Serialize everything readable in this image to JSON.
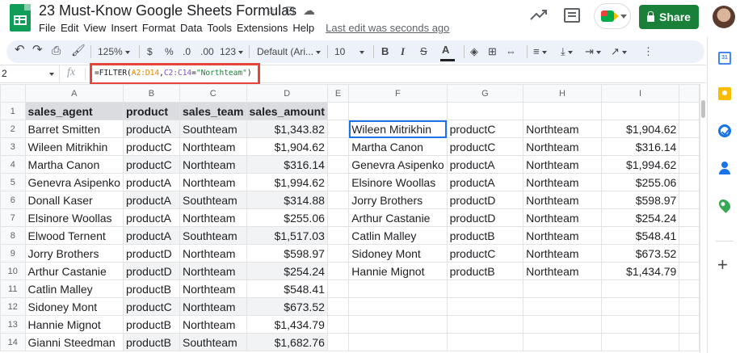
{
  "app": {
    "doc_title": "23 Must-Know Google Sheets Formulas",
    "menu": [
      "File",
      "Edit",
      "View",
      "Insert",
      "Format",
      "Data",
      "Tools",
      "Extensions",
      "Help"
    ],
    "last_edit": "Last edit was seconds ago",
    "share_label": "Share",
    "icons": [
      "star-icon",
      "move-to-folder-icon",
      "cloud-status-icon",
      "activity-trend-icon",
      "comment-icon",
      "meet-icon",
      "lock-icon",
      "avatar"
    ],
    "colors": {
      "share": "#188038",
      "highlight_box": "#e8433a",
      "selection": "#1a73e8"
    }
  },
  "toolbar": {
    "zoom": "125%",
    "currency": "$",
    "percent": "%",
    "decrease_decimal": ".0",
    "increase_decimal": ".00",
    "more_formats": "123",
    "font": "Default (Ari...",
    "font_size": "10",
    "bold": "B",
    "italic": "I",
    "strike": "S",
    "text_color": "A"
  },
  "formula_bar": {
    "name_box": "2",
    "fx": "fx",
    "formula_prefix": "=FILTER(",
    "range1": "A2:D14",
    "comma": ",",
    "range2": "C2:C14",
    "equals": "=",
    "criterion": "\"Northteam\"",
    "close": ")"
  },
  "columns": [
    "A",
    "B",
    "C",
    "D",
    "E",
    "F",
    "G",
    "H",
    "I"
  ],
  "rows": [
    [
      "sales_agent",
      "product",
      "sales_team",
      "sales_amount",
      "",
      "",
      "",
      "",
      ""
    ],
    [
      "Barret Smitten",
      "productA",
      "Southteam",
      "$1,343.82",
      "",
      "Wileen Mitrikhin",
      "productC",
      "Northteam",
      "$1,904.62"
    ],
    [
      "Wileen Mitrikhin",
      "productC",
      "Northteam",
      "$1,904.62",
      "",
      "Martha Canon",
      "productC",
      "Northteam",
      "$316.14"
    ],
    [
      "Martha Canon",
      "productC",
      "Northteam",
      "$316.14",
      "",
      "Genevra Asipenko",
      "productA",
      "Northteam",
      "$1,994.62"
    ],
    [
      "Genevra Asipenko",
      "productA",
      "Northteam",
      "$1,994.62",
      "",
      "Elsinore Woollas",
      "productA",
      "Northteam",
      "$255.06"
    ],
    [
      "Donall Kaser",
      "productA",
      "Southteam",
      "$314.88",
      "",
      "Jorry Brothers",
      "productD",
      "Northteam",
      "$598.97"
    ],
    [
      "Elsinore Woollas",
      "productA",
      "Northteam",
      "$255.06",
      "",
      "Arthur Castanie",
      "productD",
      "Northteam",
      "$254.24"
    ],
    [
      "Elwood Ternent",
      "productA",
      "Southteam",
      "$1,517.03",
      "",
      "Catlin Malley",
      "productB",
      "Northteam",
      "$548.41"
    ],
    [
      "Jorry Brothers",
      "productD",
      "Northteam",
      "$598.97",
      "",
      "Sidoney Mont",
      "productC",
      "Northteam",
      "$673.52"
    ],
    [
      "Arthur Castanie",
      "productD",
      "Northteam",
      "$254.24",
      "",
      "Hannie Mignot",
      "productB",
      "Northteam",
      "$1,434.79"
    ],
    [
      "Catlin Malley",
      "productB",
      "Northteam",
      "$548.41",
      "",
      "",
      "",
      "",
      ""
    ],
    [
      "Sidoney Mont",
      "productC",
      "Northteam",
      "$673.52",
      "",
      "",
      "",
      "",
      ""
    ],
    [
      "Hannie Mignot",
      "productB",
      "Northteam",
      "$1,434.79",
      "",
      "",
      "",
      "",
      ""
    ],
    [
      "Gianni Steedman",
      "productB",
      "Southteam",
      "$1,682.76",
      "",
      "",
      "",
      "",
      ""
    ]
  ],
  "side_panel": [
    "calendar-icon",
    "keep-icon",
    "tasks-icon",
    "contacts-icon",
    "maps-icon",
    "add-addon-icon"
  ]
}
